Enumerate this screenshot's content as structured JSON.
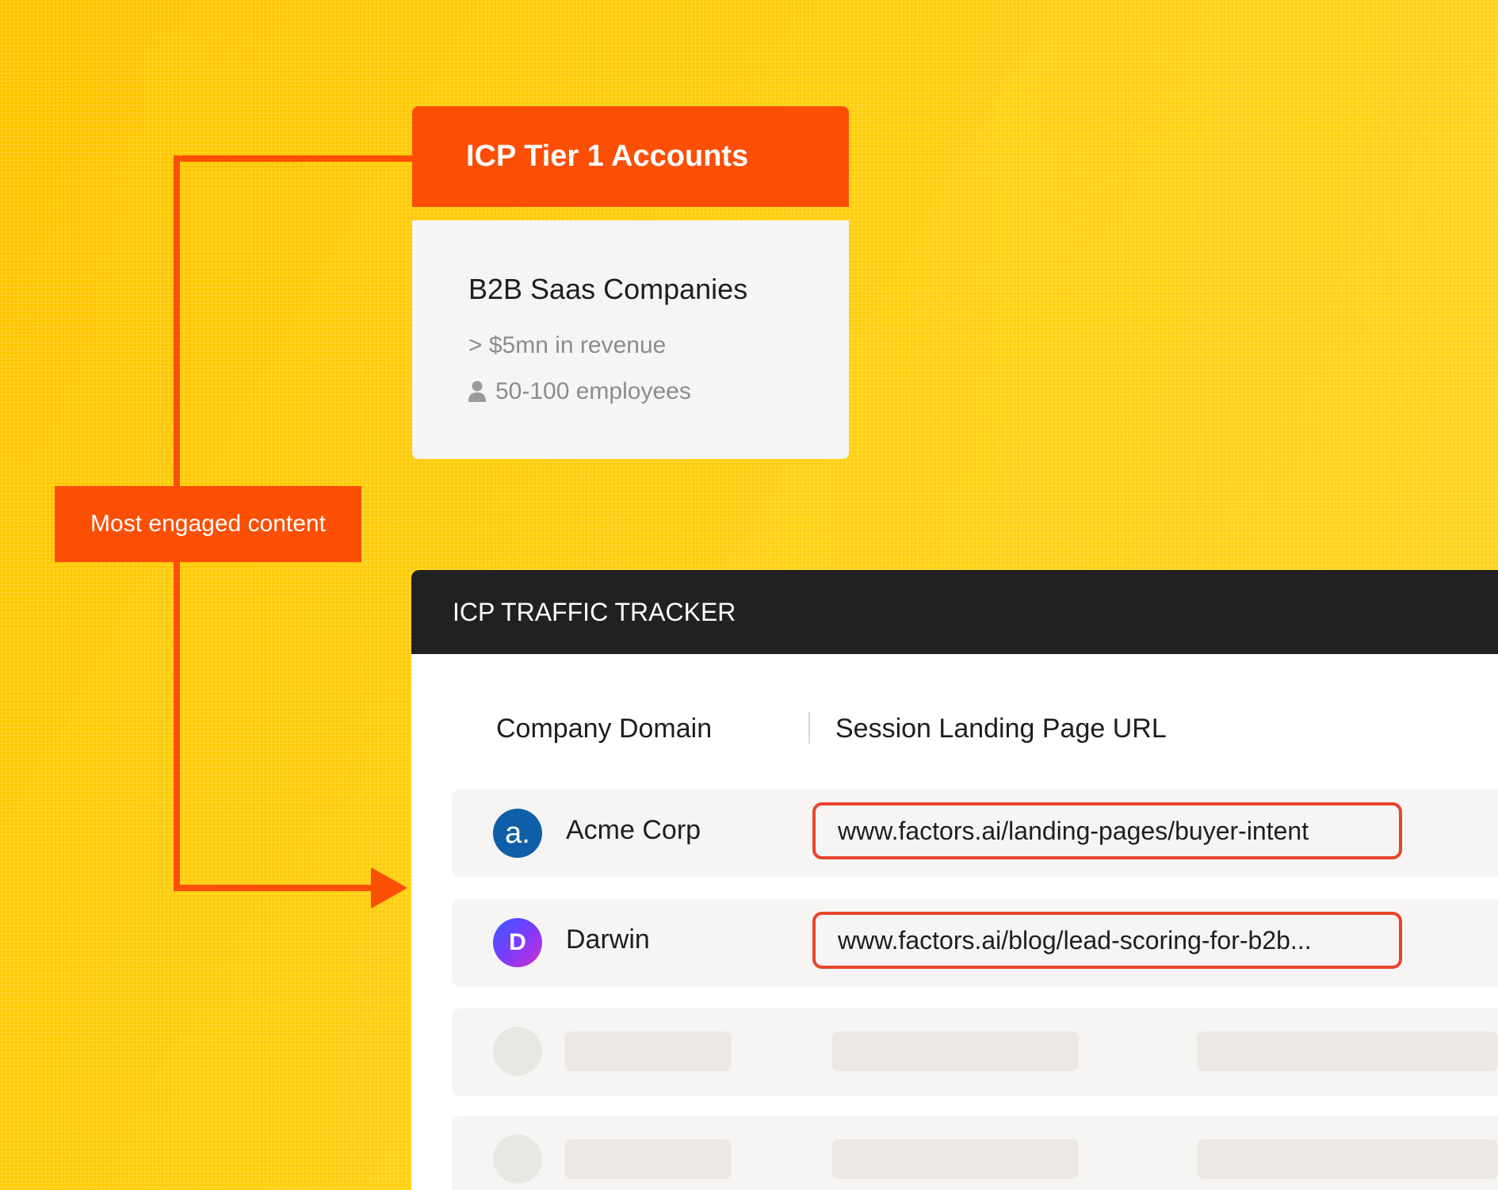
{
  "connector": {
    "label": "Most engaged content",
    "color": "#fb4f06"
  },
  "icp_card": {
    "header": "ICP Tier 1 Accounts",
    "title": "B2B Saas Companies",
    "revenue": "> $5mn in revenue",
    "employees": "50-100 employees",
    "employees_icon": "person-icon"
  },
  "tracker": {
    "title": "ICP TRAFFIC TRACKER",
    "columns": [
      "Company Domain",
      "Session Landing Page URL"
    ],
    "rows": [
      {
        "logo_text": "a.",
        "logo_icon": "acme-logo-icon",
        "logo_color": "#0f5fa8",
        "name": "Acme Corp",
        "url": "www.factors.ai/landing-pages/buyer-intent"
      },
      {
        "logo_text": "D",
        "logo_icon": "darwin-logo-icon",
        "logo_color": "#7a3cff",
        "name": "Darwin",
        "url": "www.factors.ai/blog/lead-scoring-for-b2b..."
      }
    ]
  },
  "colors": {
    "background": "#ffc807",
    "accent": "#fb4f06",
    "url_highlight": "#e8452b",
    "dark_header": "#212121"
  }
}
